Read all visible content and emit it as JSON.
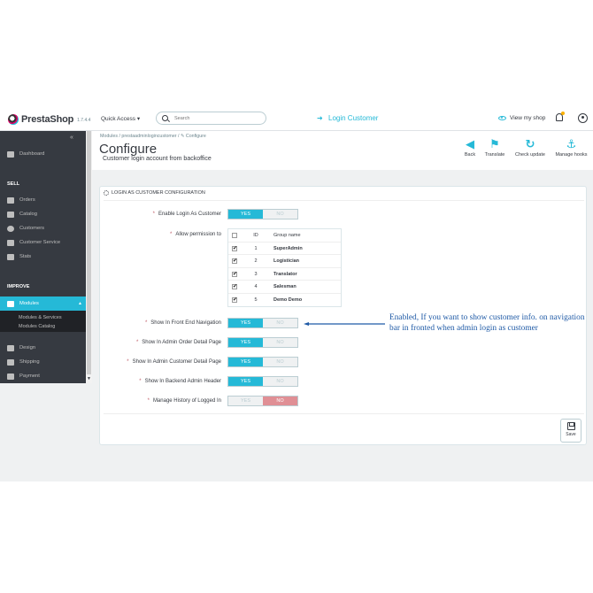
{
  "header": {
    "logo_text": "PrestaShop",
    "version": "1.7.4.4",
    "quick_access": "Quick Access ▾",
    "search_placeholder": "Search",
    "login_customer": "Login Customer",
    "view_shop": "View my shop"
  },
  "sidebar": {
    "dashboard": "Dashboard",
    "section_sell": "SELL",
    "orders": "Orders",
    "catalog": "Catalog",
    "customers": "Customers",
    "customer_service": "Customer Service",
    "stats": "Stats",
    "section_improve": "IMPROVE",
    "modules": "Modules",
    "modules_services": "Modules & Services",
    "modules_catalog": "Modules Catalog",
    "design": "Design",
    "shipping": "Shipping",
    "payment": "Payment"
  },
  "page": {
    "breadcrumb": "Modules  /  prestaadminlogincustomer  /  ✎ Configure",
    "title": "Configure",
    "subtitle": "Customer login account from backoffice"
  },
  "toolbar": {
    "back": "Back",
    "translate": "Translate",
    "check_update": "Check update",
    "manage_hooks": "Manage hooks"
  },
  "panel": {
    "heading": "LOGIN AS CUSTOMER CONFIGURATION",
    "fields": {
      "enable_login": "Enable Login As Customer",
      "allow_permission": "Allow permission to",
      "front_end_nav": "Show In Front End Navigation",
      "admin_order": "Show In Admin Order Detail Page",
      "admin_customer": "Show In Admin Customer Detail Page",
      "backend_header": "Show In Backend Admin Header",
      "manage_history": "Manage History of Logged In"
    },
    "yes": "YES",
    "no": "NO",
    "table": {
      "col_id": "ID",
      "col_group": "Group name",
      "rows": [
        {
          "id": "1",
          "name": "SuperAdmin",
          "checked": "✔"
        },
        {
          "id": "2",
          "name": "Logistician",
          "checked": "✔"
        },
        {
          "id": "3",
          "name": "Translator",
          "checked": "✔"
        },
        {
          "id": "4",
          "name": "Salesman",
          "checked": "✔"
        },
        {
          "id": "5",
          "name": "Demo Demo",
          "checked": "✔"
        }
      ]
    },
    "save": "Save"
  },
  "annotation": "Enabled, If you want to show customer info. on navigation bar in fronted when admin login as customer",
  "colors": {
    "accent": "#25b9d7",
    "sidebar_bg": "#363a41",
    "no_active": "#e08f95",
    "annotation": "#1f5aa6"
  }
}
